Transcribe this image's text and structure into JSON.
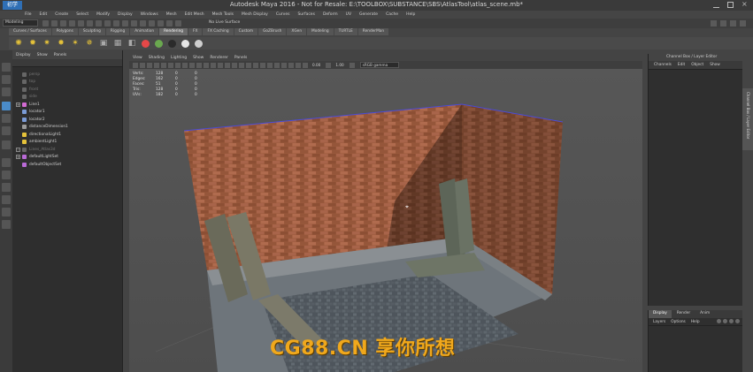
{
  "window": {
    "title": "Autodesk Maya 2016 - Not for Resale: E:\\TOOLBOX\\SUBSTANCE\\SBS\\AtlasTool\\atlas_scene.mb*",
    "logo_text": "初学"
  },
  "menubar": [
    "File",
    "Edit",
    "Create",
    "Select",
    "Modify",
    "Display",
    "Windows",
    "Mesh",
    "Edit Mesh",
    "Mesh Tools",
    "Mesh Display",
    "Curves",
    "Surfaces",
    "Deform",
    "UV",
    "Generate",
    "Cache",
    "Help"
  ],
  "statusline": {
    "mode": "Modeling",
    "live_surface": "No Live Surface"
  },
  "shelf": {
    "tabs": [
      "Curves / Surfaces",
      "Polygons",
      "Sculpting",
      "Rigging",
      "Animation",
      "Rendering",
      "FX",
      "FX Caching",
      "Custom",
      "GoZBrush",
      "XGen",
      "Modeling",
      "TURTLE",
      "RenderMan"
    ],
    "active_tab": "Rendering",
    "icon_colors": [
      "#e54848",
      "#6aa84f",
      "#2b2b2b",
      "#e6e6e6",
      "#cfcfcf"
    ]
  },
  "outliner": {
    "menu": [
      "Display",
      "Show",
      "Panels"
    ],
    "items": [
      {
        "label": "persp",
        "dim": true
      },
      {
        "label": "top",
        "dim": true
      },
      {
        "label": "front",
        "dim": true
      },
      {
        "label": "side",
        "dim": true
      },
      {
        "label": "Line1",
        "dim": false,
        "expandable": true
      },
      {
        "label": "locator1",
        "dim": false
      },
      {
        "label": "locator2",
        "dim": false
      },
      {
        "label": "distanceDimension1",
        "dim": false
      },
      {
        "label": "directionalLight1",
        "dim": false
      },
      {
        "label": "ambientLight1",
        "dim": false
      },
      {
        "label": "Lines_Atlas3d",
        "dim": true,
        "expandable": true
      },
      {
        "label": "defaultLightSet",
        "dim": false,
        "expandable": true
      },
      {
        "label": "defaultObjectSet",
        "dim": false
      }
    ]
  },
  "viewport": {
    "menu": [
      "View",
      "Shading",
      "Lighting",
      "Show",
      "Renderer",
      "Panels"
    ],
    "field_a": "0.00",
    "field_b": "1.00",
    "color_space": "sRGB gamma",
    "hud": [
      {
        "label": "Verts:",
        "a": "128",
        "b": "0",
        "c": "0"
      },
      {
        "label": "Edges:",
        "a": "162",
        "b": "0",
        "c": "0"
      },
      {
        "label": "Faces:",
        "a": "51",
        "b": "0",
        "c": "0"
      },
      {
        "label": "Tris:",
        "a": "128",
        "b": "0",
        "c": "0"
      },
      {
        "label": "UVs:",
        "a": "182",
        "b": "0",
        "c": "0"
      }
    ]
  },
  "channelbox": {
    "title": "Channel Box / Layer Editor",
    "menu": [
      "Channels",
      "Edit",
      "Object",
      "Show"
    ],
    "side_tab": "Channel Box / Layer Editor"
  },
  "layer_editor": {
    "tabs": [
      "Display",
      "Render",
      "Anim"
    ],
    "active_tab": "Display",
    "menu": [
      "Layers",
      "Options",
      "Help"
    ]
  },
  "watermark": "CG88.CN 享你所想"
}
